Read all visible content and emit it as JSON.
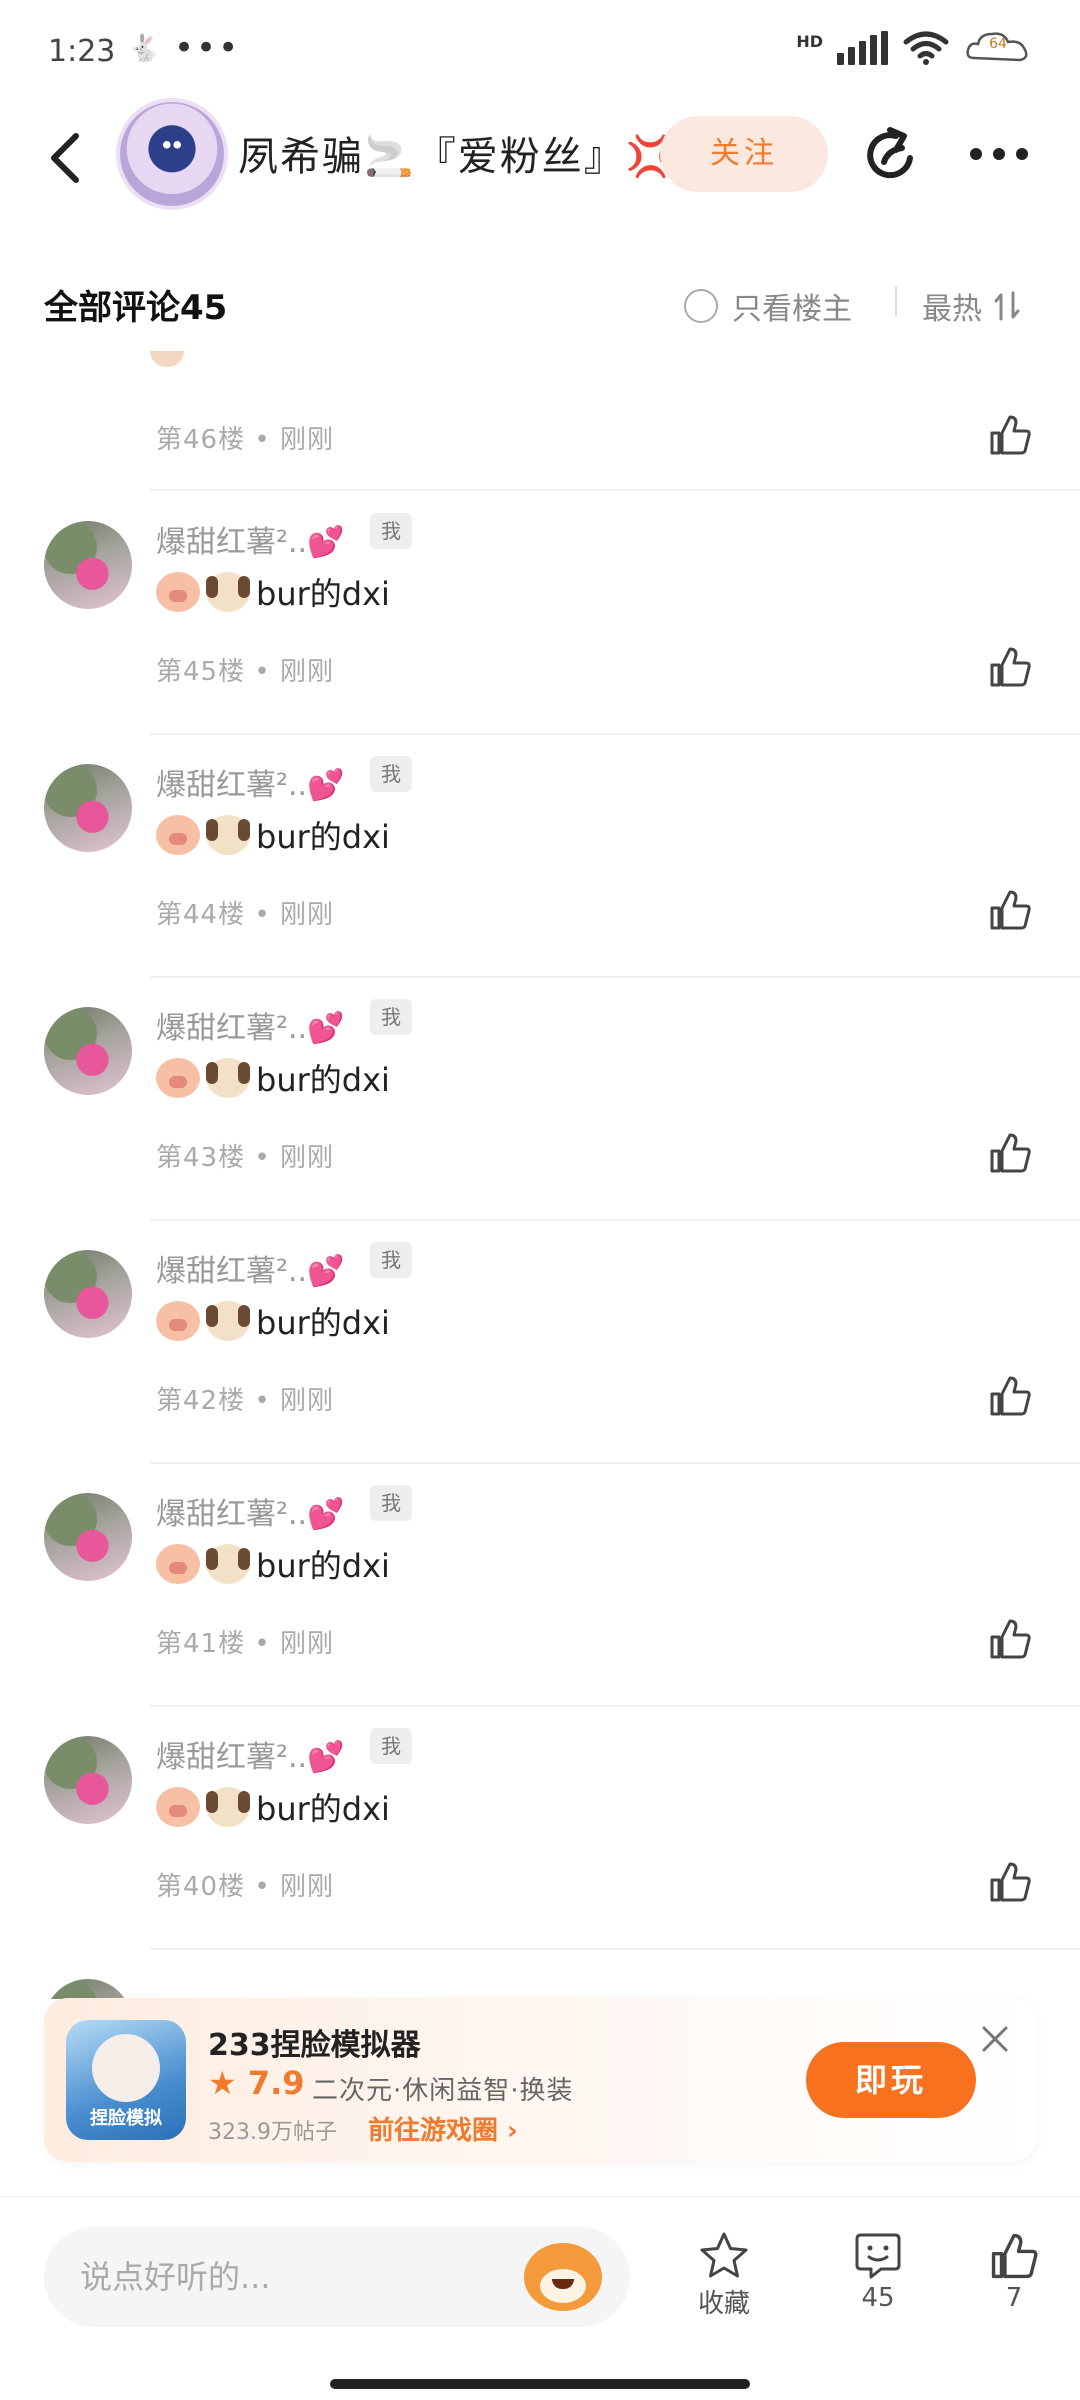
{
  "status_bar": {
    "time": "1:23",
    "network": "HD",
    "battery": "64"
  },
  "header": {
    "back_icon": "back-arrow-icon",
    "title": "夙希骗🚬『爱粉丝』💢",
    "follow_label": "关注",
    "share_icon": "share-icon",
    "more_icon": "more-icon"
  },
  "comments_bar": {
    "title": "全部评论45",
    "only_op_label": "只看楼主",
    "sort_label": "最热"
  },
  "partial_top": {
    "meta": "第46楼 • 刚刚"
  },
  "comments": [
    {
      "name": "爆甜红薯²..💕",
      "badge": "我",
      "text": "bur的dxi",
      "meta": "第45楼 • 刚刚"
    },
    {
      "name": "爆甜红薯²..💕",
      "badge": "我",
      "text": "bur的dxi",
      "meta": "第44楼 • 刚刚"
    },
    {
      "name": "爆甜红薯²..💕",
      "badge": "我",
      "text": "bur的dxi",
      "meta": "第43楼 • 刚刚"
    },
    {
      "name": "爆甜红薯²..💕",
      "badge": "我",
      "text": "bur的dxi",
      "meta": "第42楼 • 刚刚"
    },
    {
      "name": "爆甜红薯²..💕",
      "badge": "我",
      "text": "bur的dxi",
      "meta": "第41楼 • 刚刚"
    },
    {
      "name": "爆甜红薯²..💕",
      "badge": "我",
      "text": "bur的dxi",
      "meta": "第40楼 • 刚刚"
    }
  ],
  "ad": {
    "icon_text": "捏脸模拟",
    "title": "233捏脸模拟器",
    "rating": "★ 7.9",
    "tags": "二次元·休闲益智·换装",
    "posts": "323.9万帖子",
    "link": "前往游戏圈 ›",
    "play_label": "即玩"
  },
  "bottom_bar": {
    "input_placeholder": "说点好听的...",
    "collect_label": "收藏",
    "comment_count": "45",
    "like_count": "7"
  }
}
